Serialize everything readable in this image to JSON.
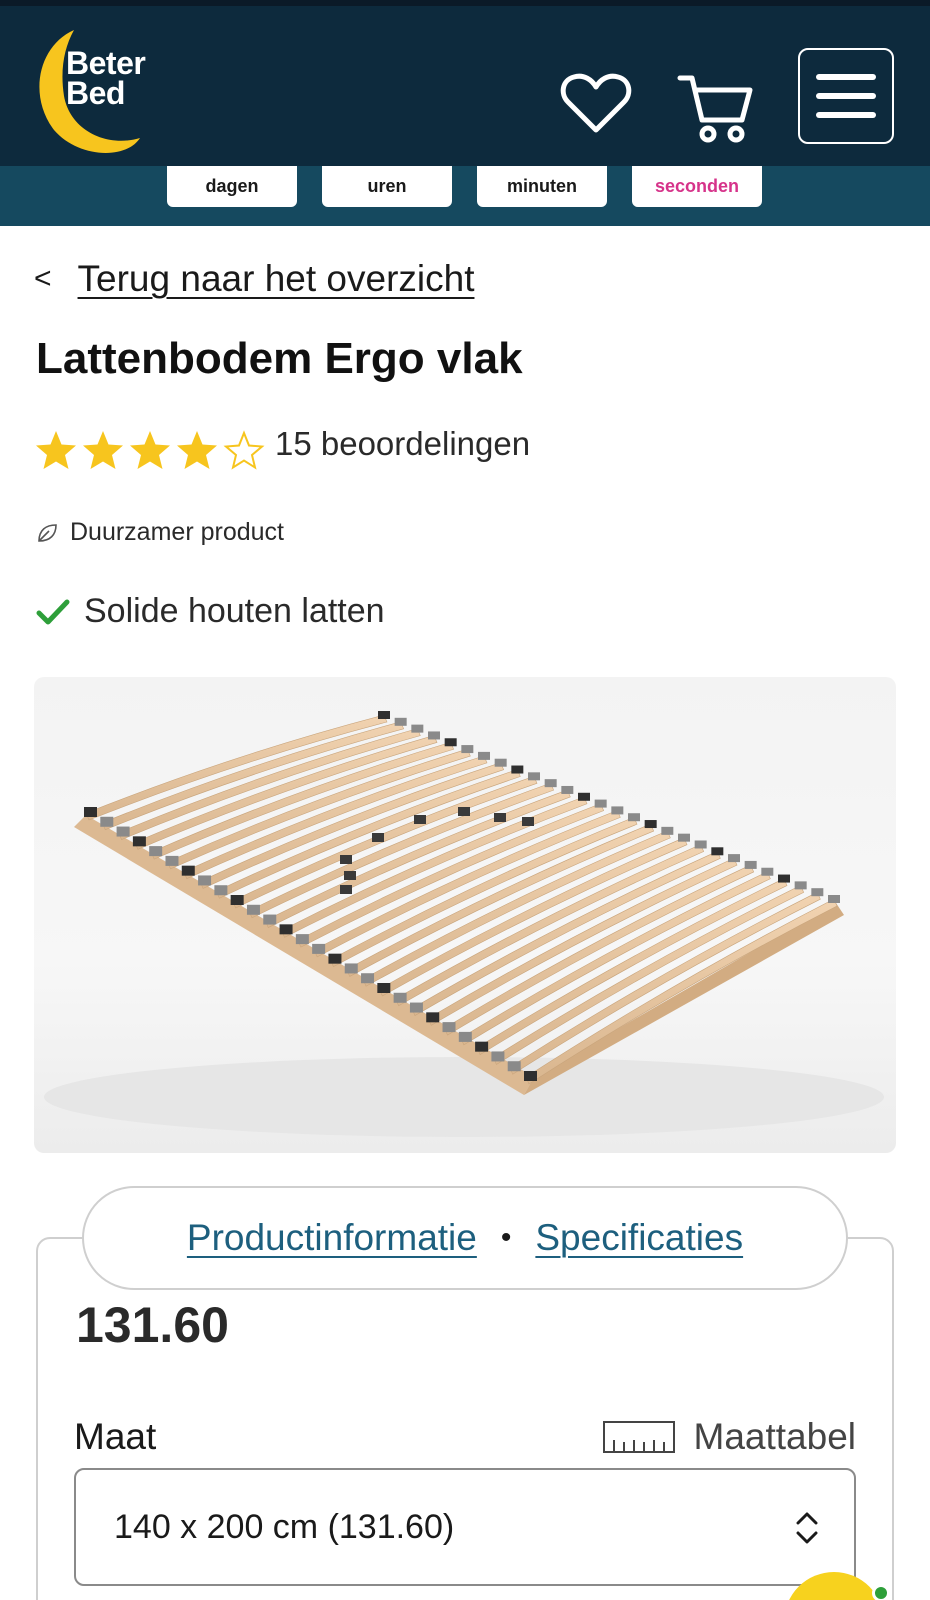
{
  "header": {
    "logo_line1": "Beter",
    "logo_line2": "Bed",
    "icons": [
      "heart-icon",
      "cart-icon",
      "menu-icon"
    ]
  },
  "countdown": {
    "units": [
      "dagen",
      "uren",
      "minuten",
      "seconden"
    ]
  },
  "back_link": "Terug naar het overzicht",
  "product": {
    "title": "Lattenbodem Ergo vlak",
    "rating": 4,
    "rating_max": 5,
    "reviews": "15 beoordelingen",
    "sustainability": "Duurzamer product",
    "usp": "Solide houten latten"
  },
  "tabs": {
    "info": "Productinformatie",
    "specs": "Specificaties"
  },
  "price": "131.60",
  "size": {
    "label": "Maat",
    "chart_link": "Maattabel",
    "selected": "140 x 200 cm (131.60)"
  },
  "colors": {
    "header_bg": "#0d2a3d",
    "countdown_bg": "#15495f",
    "star": "#f7c51e",
    "check": "#2e9f3a",
    "link": "#1d5f7e",
    "seconds": "#d6338a"
  }
}
